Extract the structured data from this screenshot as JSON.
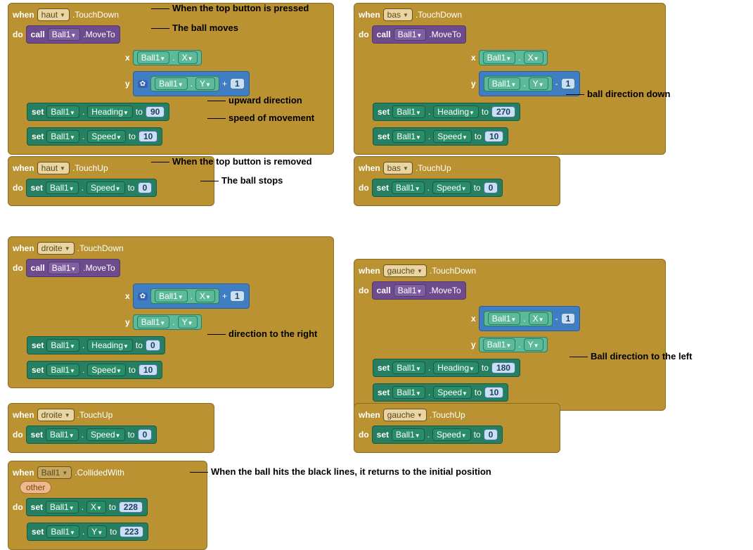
{
  "kw": {
    "when": "when",
    "do": "do",
    "call": "call",
    "set": "set",
    "to": "to",
    "x": "x",
    "y": "y"
  },
  "obj": {
    "ball": "Ball1",
    "haut": "haut",
    "bas": "bas",
    "droite": "droite",
    "gauche": "gauche"
  },
  "ev": {
    "touchdown": ".TouchDown",
    "touchup": ".TouchUp",
    "moveto": ".MoveTo",
    "collided": ".CollidedWith"
  },
  "prop": {
    "heading": "Heading",
    "speed": "Speed",
    "x": "X",
    "y": "Y"
  },
  "op": {
    "plus": "+",
    "minus": "-"
  },
  "val": {
    "v1": "1",
    "v10": "10",
    "v0": "0",
    "v90": "90",
    "v180": "180",
    "v270": "270",
    "v228": "228",
    "v223": "223"
  },
  "misc": {
    "other": "other",
    "dot": "."
  },
  "labels": {
    "l1": "When the top button is pressed",
    "l2": "The ball moves",
    "l3": "upward direction",
    "l4": "speed of movement",
    "l5": "When the top button is removed",
    "l6": "The ball stops",
    "l7": "ball direction down",
    "l8": "direction to the right",
    "l9": "Ball direction to the left",
    "l10": "When the ball hits the black lines, it returns to the initial position"
  }
}
